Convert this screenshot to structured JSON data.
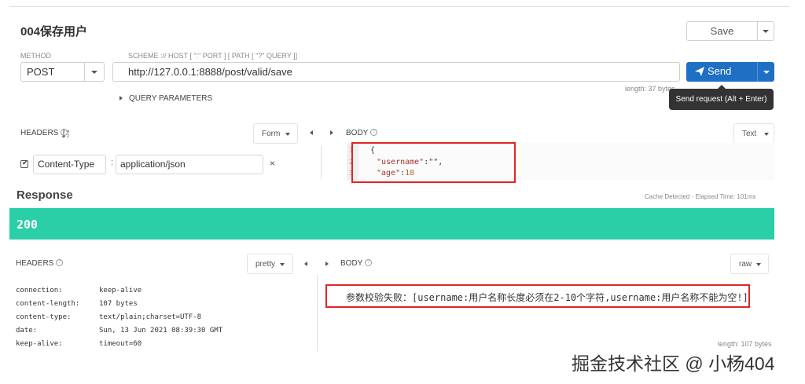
{
  "request": {
    "title": "004保存用户",
    "method_label": "METHOD",
    "method": "POST",
    "url_label": "SCHEME :// HOST [ \":\" PORT ] [ PATH [ \"?\" QUERY ]]",
    "url": "http://127.0.0.1:8888/post/valid/save",
    "save_label": "Save",
    "send_label": "Send",
    "length_label": "length: 37 bytes",
    "tooltip": "Send request (Alt + Enter)",
    "query_params_label": "QUERY PARAMETERS"
  },
  "headers": {
    "label": "HEADERS",
    "format": "Form",
    "items": [
      {
        "key": "Content-Type",
        "value": "application/json",
        "checked": true
      }
    ]
  },
  "body": {
    "label": "BODY",
    "format": "Text",
    "lines": [
      {
        "n": "1",
        "text": "{"
      },
      {
        "n": "2",
        "key": "\"username\"",
        "rest": ":\"\","
      },
      {
        "n": "3",
        "key": "\"age\"",
        "rest": ":",
        "num": "18"
      }
    ]
  },
  "response": {
    "title": "Response",
    "cache_info": "Cache Detected - Elapsed Time: 101ms",
    "status": "200",
    "headers_label": "HEADERS",
    "headers_format": "pretty",
    "body_label": "BODY",
    "body_format": "raw",
    "headers": [
      {
        "k": "connection:",
        "v": "keep-alive"
      },
      {
        "k": "content-length:",
        "v": "107 bytes"
      },
      {
        "k": "content-type:",
        "v": "text/plain;charset=UTF-8"
      },
      {
        "k": "date:",
        "v": "Sun, 13 Jun 2021 08:39:30 GMT"
      },
      {
        "k": "keep-alive:",
        "v": "timeout=60"
      }
    ],
    "body_text": "参数校验失败：[username:用户名称长度必须在2-10个字符,username:用户名称不能为空!]",
    "length_label": "length: 107 bytes"
  },
  "watermark": "掘金技术社区 @ 小杨404",
  "colors": {
    "send": "#1f6fc4",
    "status_ok": "#2acfa8",
    "highlight": "#e02525"
  }
}
